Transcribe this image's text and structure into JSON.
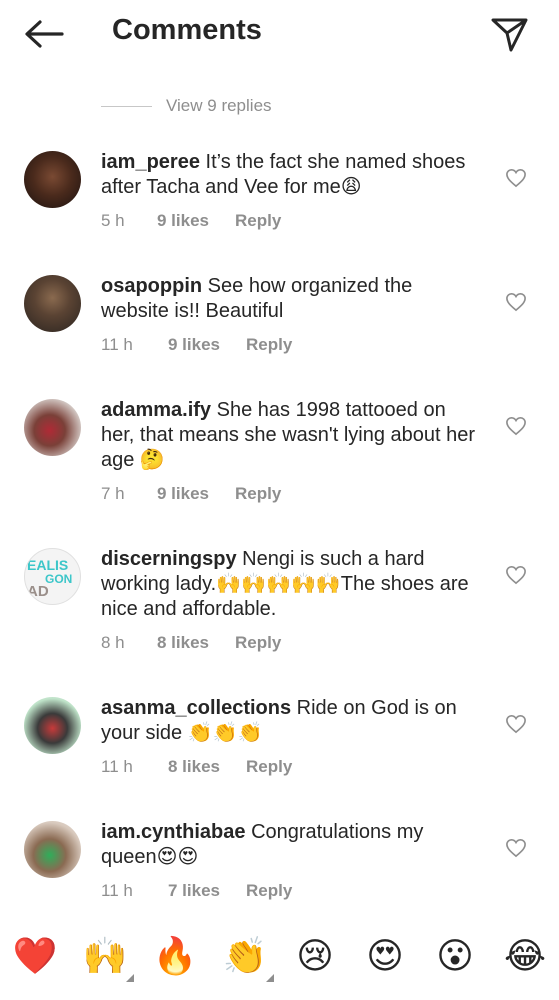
{
  "header": {
    "title": "Comments"
  },
  "view_replies": {
    "label": "View 9 replies"
  },
  "comments": [
    {
      "username": "iam_peree",
      "text": "It’s the fact she named shoes after Tacha and Vee for me😩",
      "time": "5 h",
      "likes": "9 likes",
      "reply": "Reply"
    },
    {
      "username": "osapoppin",
      "text": "See how organized the website is!! Beautiful",
      "time": "11 h",
      "likes": "9 likes",
      "reply": "Reply"
    },
    {
      "username": "adamma.ify",
      "text": "She has 1998 tattooed on her, that means she wasn't lying about her age 🤔",
      "time": "7 h",
      "likes": "9 likes",
      "reply": "Reply"
    },
    {
      "username": "discerningspy",
      "text": "Nengi is such a hard working lady.🙌🙌🙌🙌🙌The shoes are nice and affordable.",
      "time": "8 h",
      "likes": "8 likes",
      "reply": "Reply",
      "avatar_text": "EALIS GON AD"
    },
    {
      "username": "asanma_collections",
      "text": "Ride on God is on your side 👏👏👏",
      "time": "11 h",
      "likes": "8 likes",
      "reply": "Reply"
    },
    {
      "username": "iam.cynthiabae",
      "text": "Congratulations my queen😍😍",
      "time": "11 h",
      "likes": "7 likes",
      "reply": "Reply"
    }
  ],
  "emoji_bar": [
    "❤️",
    "🙌",
    "🔥",
    "👏",
    "😢",
    "😍",
    "😮",
    "😂"
  ],
  "colors": {
    "text": "#262626",
    "secondary": "#8e8e8e",
    "divider": "#c7c7c7"
  }
}
